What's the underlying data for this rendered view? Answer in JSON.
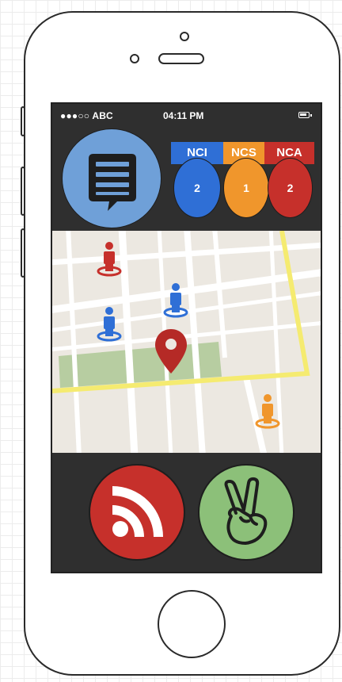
{
  "status_bar": {
    "carrier": "●●●○○ ABC",
    "time": "04:11 PM",
    "battery_icon": "battery-icon"
  },
  "chat_button": {
    "icon": "chat-list-icon",
    "color": "#6fa0d8"
  },
  "categories": [
    {
      "label": "NCI",
      "count": "2",
      "color": "#2f6fd6"
    },
    {
      "label": "NCS",
      "count": "1",
      "color": "#f0962c"
    },
    {
      "label": "NCA",
      "count": "2",
      "color": "#c6302b"
    }
  ],
  "map": {
    "markers": [
      {
        "type": "person",
        "color": "#c6302b"
      },
      {
        "type": "person",
        "color": "#2f6fd6"
      },
      {
        "type": "person",
        "color": "#2f6fd6"
      },
      {
        "type": "location-pin",
        "color": "#b52a26"
      },
      {
        "type": "person",
        "color": "#f0962c"
      }
    ],
    "boundary_color": "#f5eb70",
    "park_color": "#b7cda1"
  },
  "actions": [
    {
      "icon": "rss-feed-icon",
      "color": "#c6302b"
    },
    {
      "icon": "peace-hand-icon",
      "color": "#8cc079"
    }
  ]
}
